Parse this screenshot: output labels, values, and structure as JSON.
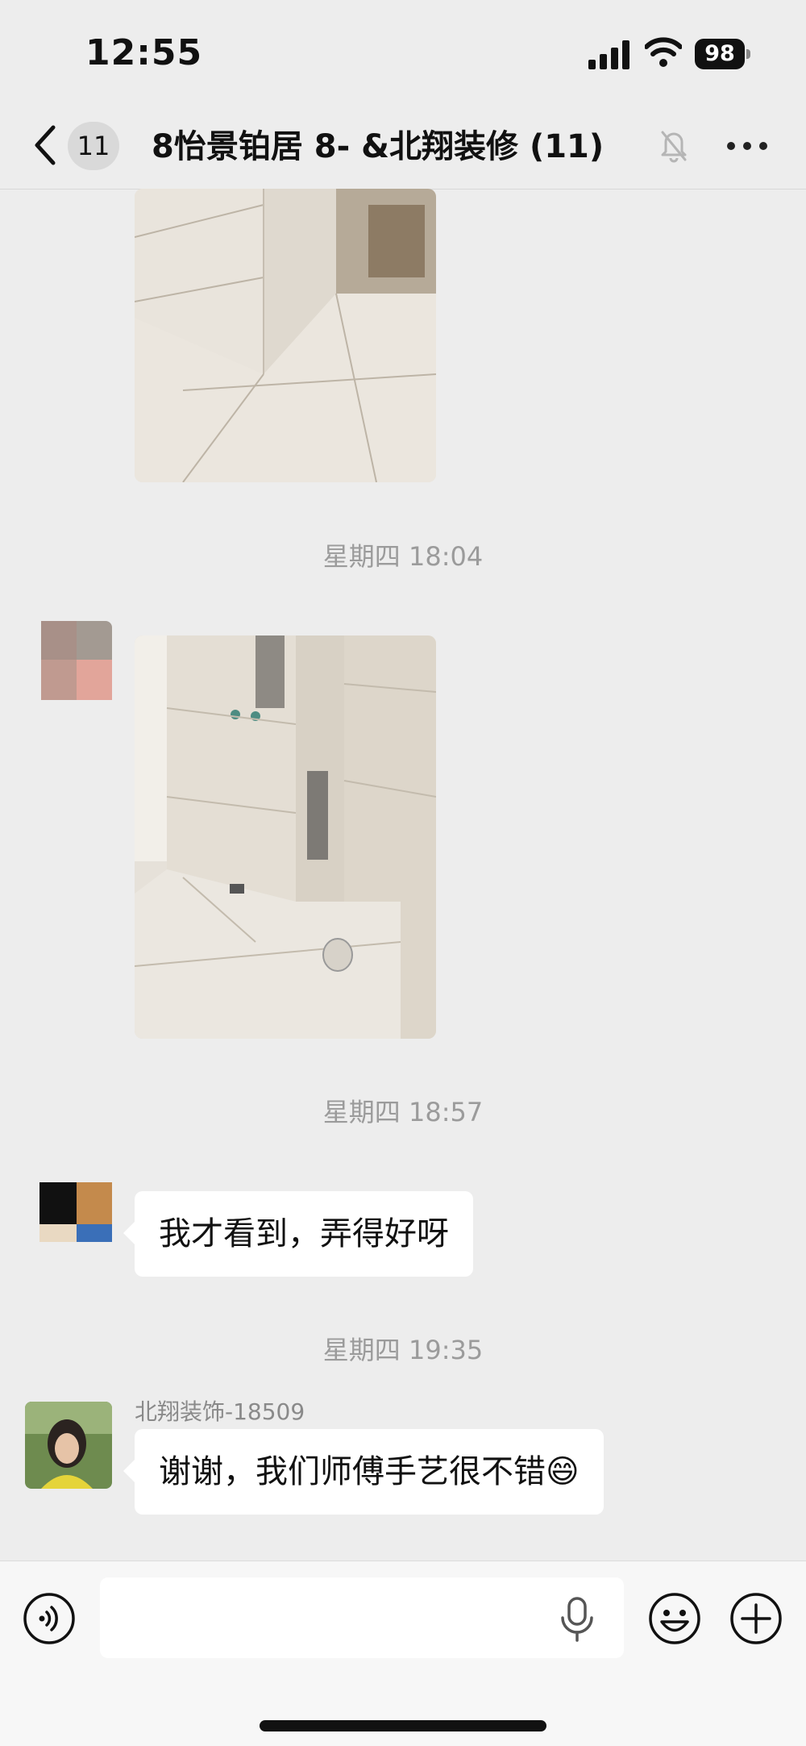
{
  "status_bar": {
    "time": "12:55",
    "battery": "98",
    "icons": [
      "cellular-signal-icon",
      "wifi-icon",
      "battery-icon"
    ]
  },
  "nav": {
    "back_icon": "chevron-left-icon",
    "unread_count": "11",
    "title": "8怡景铂居 8-      &北翔装修",
    "member_count": "(11)",
    "mute_icon": "bell-slash-icon",
    "more_icon": "more-dots-icon"
  },
  "messages": [
    {
      "type": "image",
      "content": "bathroom-tile-photo",
      "from": "other"
    },
    {
      "type": "timestamp",
      "text": "星期四 18:04"
    },
    {
      "type": "image",
      "content": "bathroom-shower-photo",
      "from": "other"
    },
    {
      "type": "timestamp",
      "text": "星期四 18:57"
    },
    {
      "type": "text",
      "text": "我才看到，弄得好呀",
      "from": "other"
    },
    {
      "type": "timestamp",
      "text": "星期四 19:35"
    },
    {
      "type": "text",
      "sender": "北翔装饰-18509",
      "text": "谢谢，我们师傅手艺很不错😄",
      "from": "other"
    }
  ],
  "input_bar": {
    "value": "",
    "voice_icon": "voice-mode-icon",
    "mic_icon": "microphone-icon",
    "emoji_icon": "emoji-icon",
    "plus_icon": "plus-icon"
  },
  "colors": {
    "background": "#ededed",
    "bubble": "#ffffff",
    "timestamp": "#9b9b9b"
  }
}
